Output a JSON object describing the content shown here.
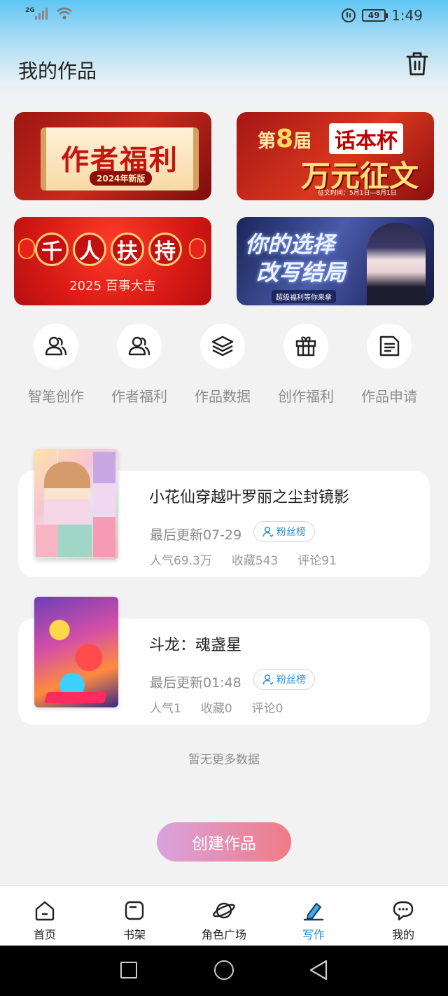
{
  "status_bar": {
    "network": "2G",
    "time": "1:49",
    "battery": "49"
  },
  "header": {
    "title": "我的作品"
  },
  "banners": [
    {
      "title": "作者福利",
      "subtitle": "2024年新版"
    },
    {
      "prefix": "第",
      "number": "8",
      "suffix": "届",
      "tag": "话本杯",
      "title": "万元征文",
      "note": "征文时间：5月1日—8月1日"
    },
    {
      "title_chars": [
        "千",
        "人",
        "扶",
        "持"
      ],
      "subtitle": "2025 百事大吉"
    },
    {
      "line1": "你的选择",
      "line2": "改写结局",
      "note": "超级福利等你来拿"
    }
  ],
  "quick_actions": [
    {
      "label": "智笔创作",
      "icon": "users-icon"
    },
    {
      "label": "作者福利",
      "icon": "users-icon"
    },
    {
      "label": "作品数据",
      "icon": "layers-icon"
    },
    {
      "label": "创作福利",
      "icon": "gift-icon"
    },
    {
      "label": "作品申请",
      "icon": "document-icon"
    }
  ],
  "works": [
    {
      "title": "小花仙穿越叶罗丽之尘封镜影",
      "updated": "最后更新07-29",
      "fans_label": "粉丝榜",
      "popularity": "人气69.3万",
      "favorites": "收藏543",
      "comments": "评论91"
    },
    {
      "title": "斗龙：魂盏星",
      "updated": "最后更新01:48",
      "fans_label": "粉丝榜",
      "popularity": "人气1",
      "favorites": "收藏0",
      "comments": "评论0"
    }
  ],
  "no_more_text": "暂无更多数据",
  "create_button": "创建作品",
  "tabs": [
    {
      "label": "首页",
      "icon": "home-icon",
      "active": false
    },
    {
      "label": "书架",
      "icon": "bookshelf-icon",
      "active": false
    },
    {
      "label": "角色广场",
      "icon": "planet-icon",
      "active": false
    },
    {
      "label": "写作",
      "icon": "pen-icon",
      "active": true
    },
    {
      "label": "我的",
      "icon": "chat-icon",
      "active": false
    }
  ],
  "colors": {
    "accent": "#1e8be6",
    "create_gradient_start": "#d9a3de",
    "create_gradient_end": "#f07b86"
  }
}
